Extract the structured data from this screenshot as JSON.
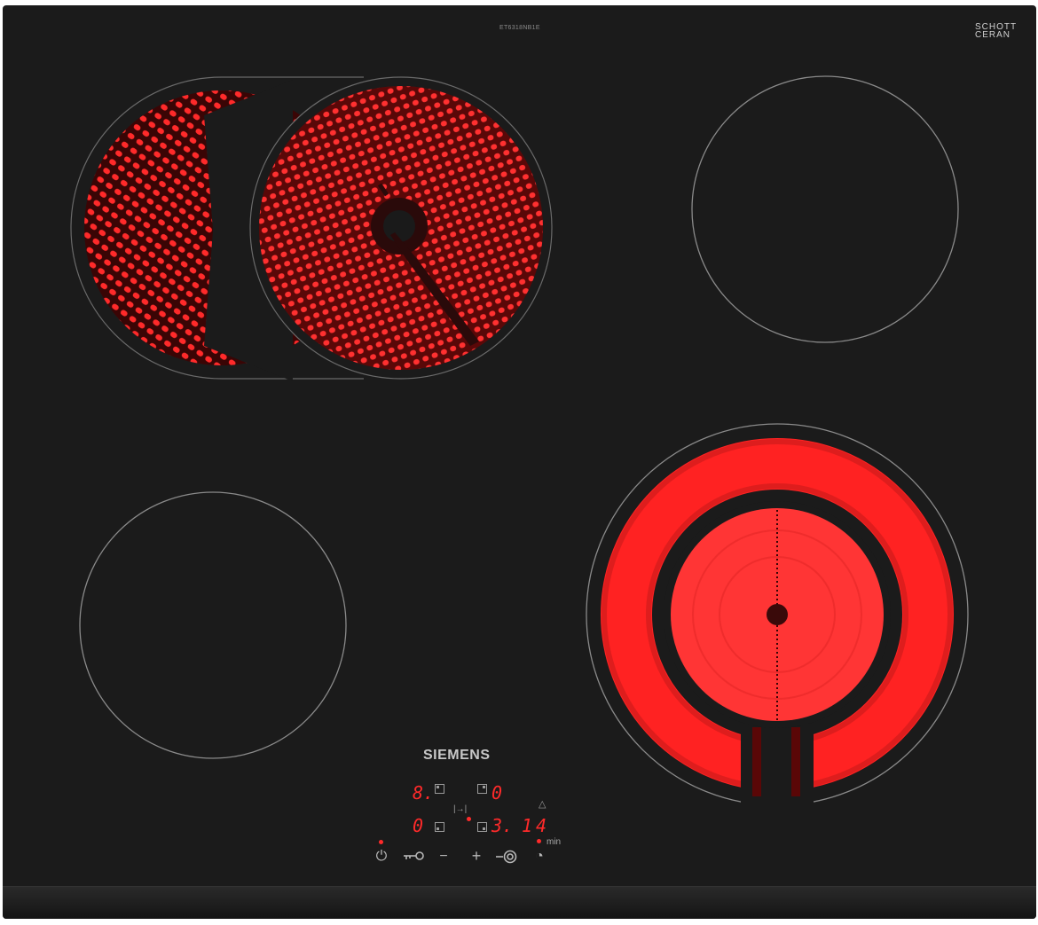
{
  "product": {
    "model_code": "ET63​18NB1E",
    "glass_brand_line1": "SCHOTT",
    "glass_brand_line2": "CERAN",
    "brand": "SIEMENS"
  },
  "zones": {
    "front_left_active": false,
    "rear_left_active": true,
    "rear_right_active": false,
    "front_right_active": true
  },
  "display": {
    "zone_rear_left": "8.",
    "zone_rear_right": "0",
    "zone_front_left": "0",
    "zone_front_right": "3.",
    "timer": "14",
    "timer_unit": "min"
  },
  "controls": {
    "power_symbol": "⏻",
    "minus_symbol": "−",
    "plus_symbol": "+",
    "timer_symbol": "◔",
    "bell_symbol": "△",
    "link_symbol": "|→|"
  },
  "colors": {
    "glass": "#1b1b1b",
    "heat": "#ff2222",
    "display_red": "#ff2a2a"
  }
}
